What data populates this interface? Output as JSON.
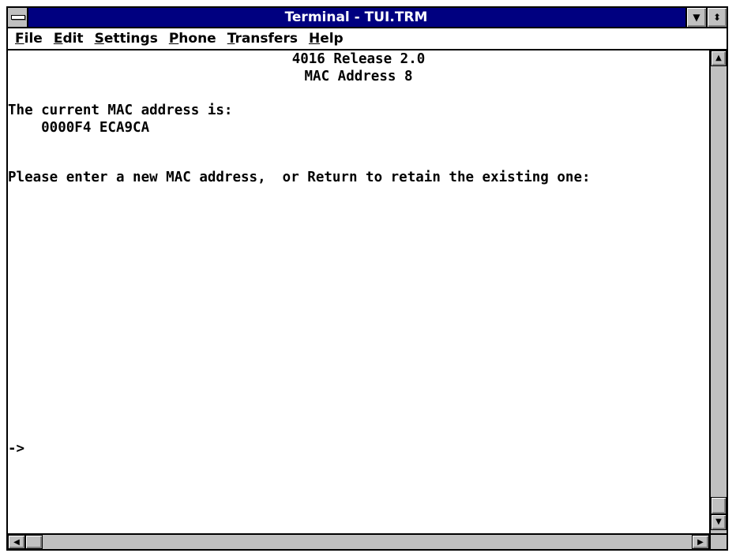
{
  "window": {
    "title": "Terminal - TUI.TRM",
    "icons": {
      "system_menu": "system-menu-icon",
      "minimize": "minimize-icon",
      "maximize": "maximize-icon",
      "minimize_glyph": "▼",
      "maximize_glyph": "⬍"
    }
  },
  "menu": {
    "file": {
      "accel": "F",
      "rest": "ile"
    },
    "edit": {
      "accel": "E",
      "rest": "dit"
    },
    "settings": {
      "accel": "S",
      "rest": "ettings"
    },
    "phone": {
      "accel": "P",
      "rest": "hone"
    },
    "transfers": {
      "accel": "T",
      "rest": "ransfers"
    },
    "help": {
      "accel": "H",
      "rest": "elp"
    }
  },
  "terminal": {
    "header_line1": "4016 Release 2.0",
    "header_line2": "MAC Address 8",
    "current_label": "The current MAC address is:",
    "current_value": "    0000F4 ECA9CA",
    "prompt_text": "Please enter a new MAC address,  or Return to retain the existing one:",
    "cursor_prompt": "->"
  },
  "scrollbars": {
    "up_arrow": "▲",
    "down_arrow": "▼",
    "left_arrow": "◀",
    "right_arrow": "▶"
  },
  "colors": {
    "title_bar": "#000080",
    "title_text": "#ffffff",
    "chrome": "#c0c0c0",
    "terminal_bg": "#ffffff"
  }
}
